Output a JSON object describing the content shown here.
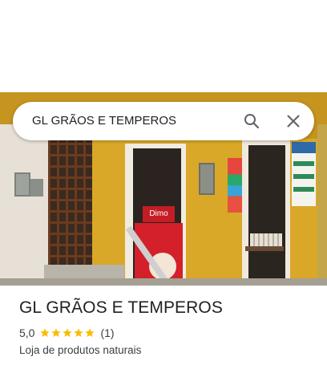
{
  "search": {
    "query": "GL GRÃOS E TEMPEROS"
  },
  "photo": {
    "fridge_brand_text": "Dimo"
  },
  "place": {
    "name": "GL GRÃOS E TEMPEROS",
    "rating": "5,0",
    "stars": 5,
    "review_count": "(1)",
    "category": "Loja de produtos naturais"
  },
  "colors": {
    "star": "#fbbc04",
    "text_primary": "#202124",
    "text_secondary": "#3c4043",
    "icon": "#5f6368"
  },
  "icons": {
    "search": "search-icon",
    "close": "close-icon",
    "star": "star-icon"
  }
}
